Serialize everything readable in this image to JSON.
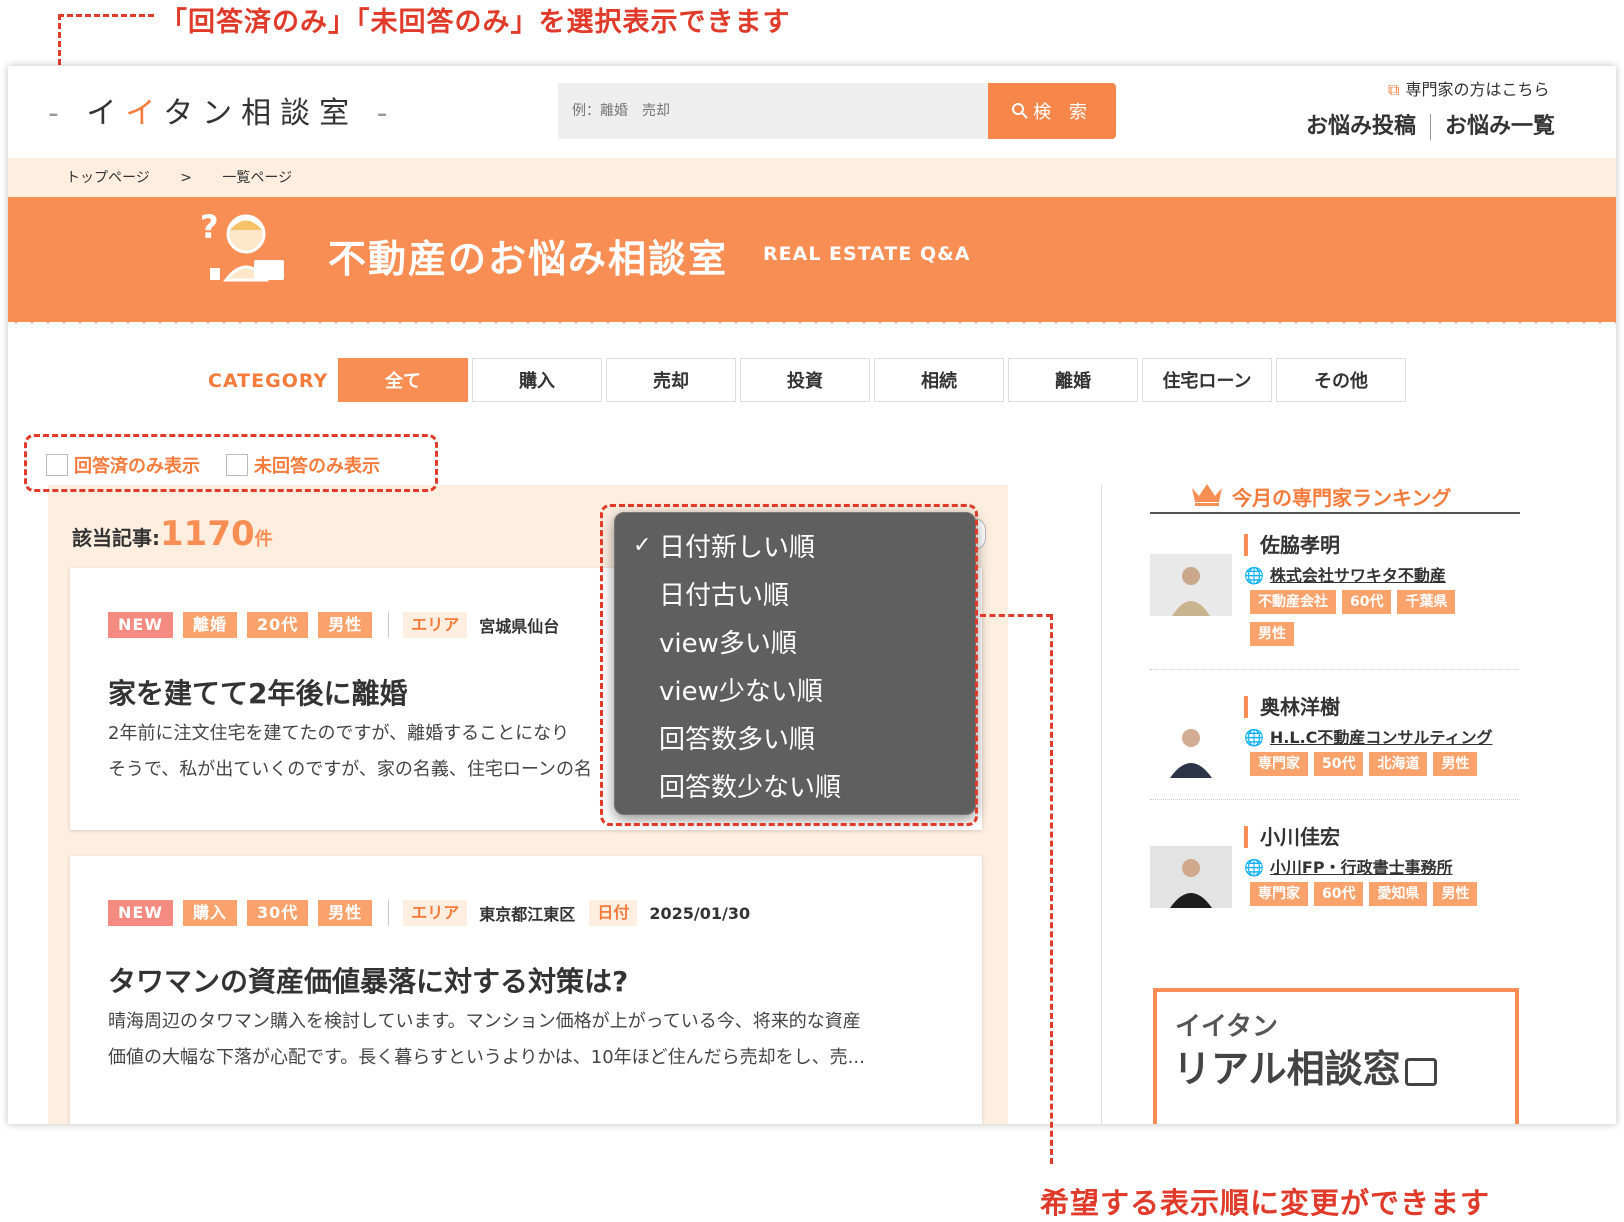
{
  "annotations": {
    "top": "「回答済のみ」「未回答のみ」を選択表示できます",
    "bottom": "希望する表示順に変更ができます"
  },
  "header": {
    "logo": {
      "dash_left": "-",
      "text_part1": "イ",
      "text_orange": "イ",
      "text_part2": "タン相談室",
      "dash_right": "-"
    },
    "search_placeholder": "例：離婚　売却",
    "search_button": "検 索",
    "expert_link": "専門家の方はこちら",
    "nav": [
      "お悩み投稿",
      "お悩み一覧"
    ]
  },
  "breadcrumb": {
    "home": "トップページ",
    "sep": ">",
    "current": "一覧ページ"
  },
  "banner": {
    "title": "不動産のお悩み相談室",
    "subtitle": "REAL ESTATE Q&A"
  },
  "category": {
    "label": "CATEGORY",
    "tabs": [
      "全て",
      "購入",
      "売却",
      "投資",
      "相続",
      "離婚",
      "住宅ローン",
      "その他"
    ],
    "active": "全て"
  },
  "filters": {
    "answered": "回答済のみ表示",
    "unanswered": "未回答のみ表示"
  },
  "results": {
    "label": "該当記事:",
    "count": "1170",
    "unit": "件"
  },
  "sort_dropdown": {
    "check": "✓",
    "options": [
      "日付新しい順",
      "日付古い順",
      "view多い順",
      "view少ない順",
      "回答数多い順",
      "回答数少ない順"
    ],
    "selected": "日付新しい順"
  },
  "articles": [
    {
      "tags": [
        "NEW",
        "離婚",
        "20代",
        "男性"
      ],
      "area_label": "エリア",
      "area": "宮城県仙台",
      "title": "家を建てて2年後に離婚",
      "body_line1": "2年前に注文住宅を建てたのですが、離婚することになり",
      "body_line2": "そうで、私が出ていくのですが、家の名義、住宅ローンの名"
    },
    {
      "tags": [
        "NEW",
        "購入",
        "30代",
        "男性"
      ],
      "area_label": "エリア",
      "area": "東京都江東区",
      "date_label": "日付",
      "date": "2025/01/30",
      "title": "タワマンの資産価値暴落に対する対策は?",
      "body_line1": "晴海周辺のタワマン購入を検討しています。マンション価格が上がっている今、将来的な資産",
      "body_line2": "価値の大幅な下落が心配です。長く暮らすというよりかは、10年ほど住んだら売却をし、売..."
    }
  ],
  "ranking": {
    "title": "今月の専門家ランキング",
    "experts": [
      {
        "name": "佐脇孝明",
        "company": "株式会社サワキタ不動産",
        "tags": [
          "不動産会社",
          "60代",
          "千葉県",
          "男性"
        ]
      },
      {
        "name": "奥林洋樹",
        "company": "H.L.C不動産コンサルティング",
        "tags": [
          "専門家",
          "50代",
          "北海道",
          "男性"
        ]
      },
      {
        "name": "小川佳宏",
        "company": "小川FP・行政書士事務所",
        "tags": [
          "専門家",
          "60代",
          "愛知県",
          "男性"
        ]
      }
    ],
    "promo_line1": "イイタン",
    "promo_line2": "リアル相談窓"
  },
  "colors": {
    "accent": "#f98e55",
    "annotation": "#e03b2a",
    "new_tag": "#f48a80",
    "tag": "#f9a26b"
  }
}
